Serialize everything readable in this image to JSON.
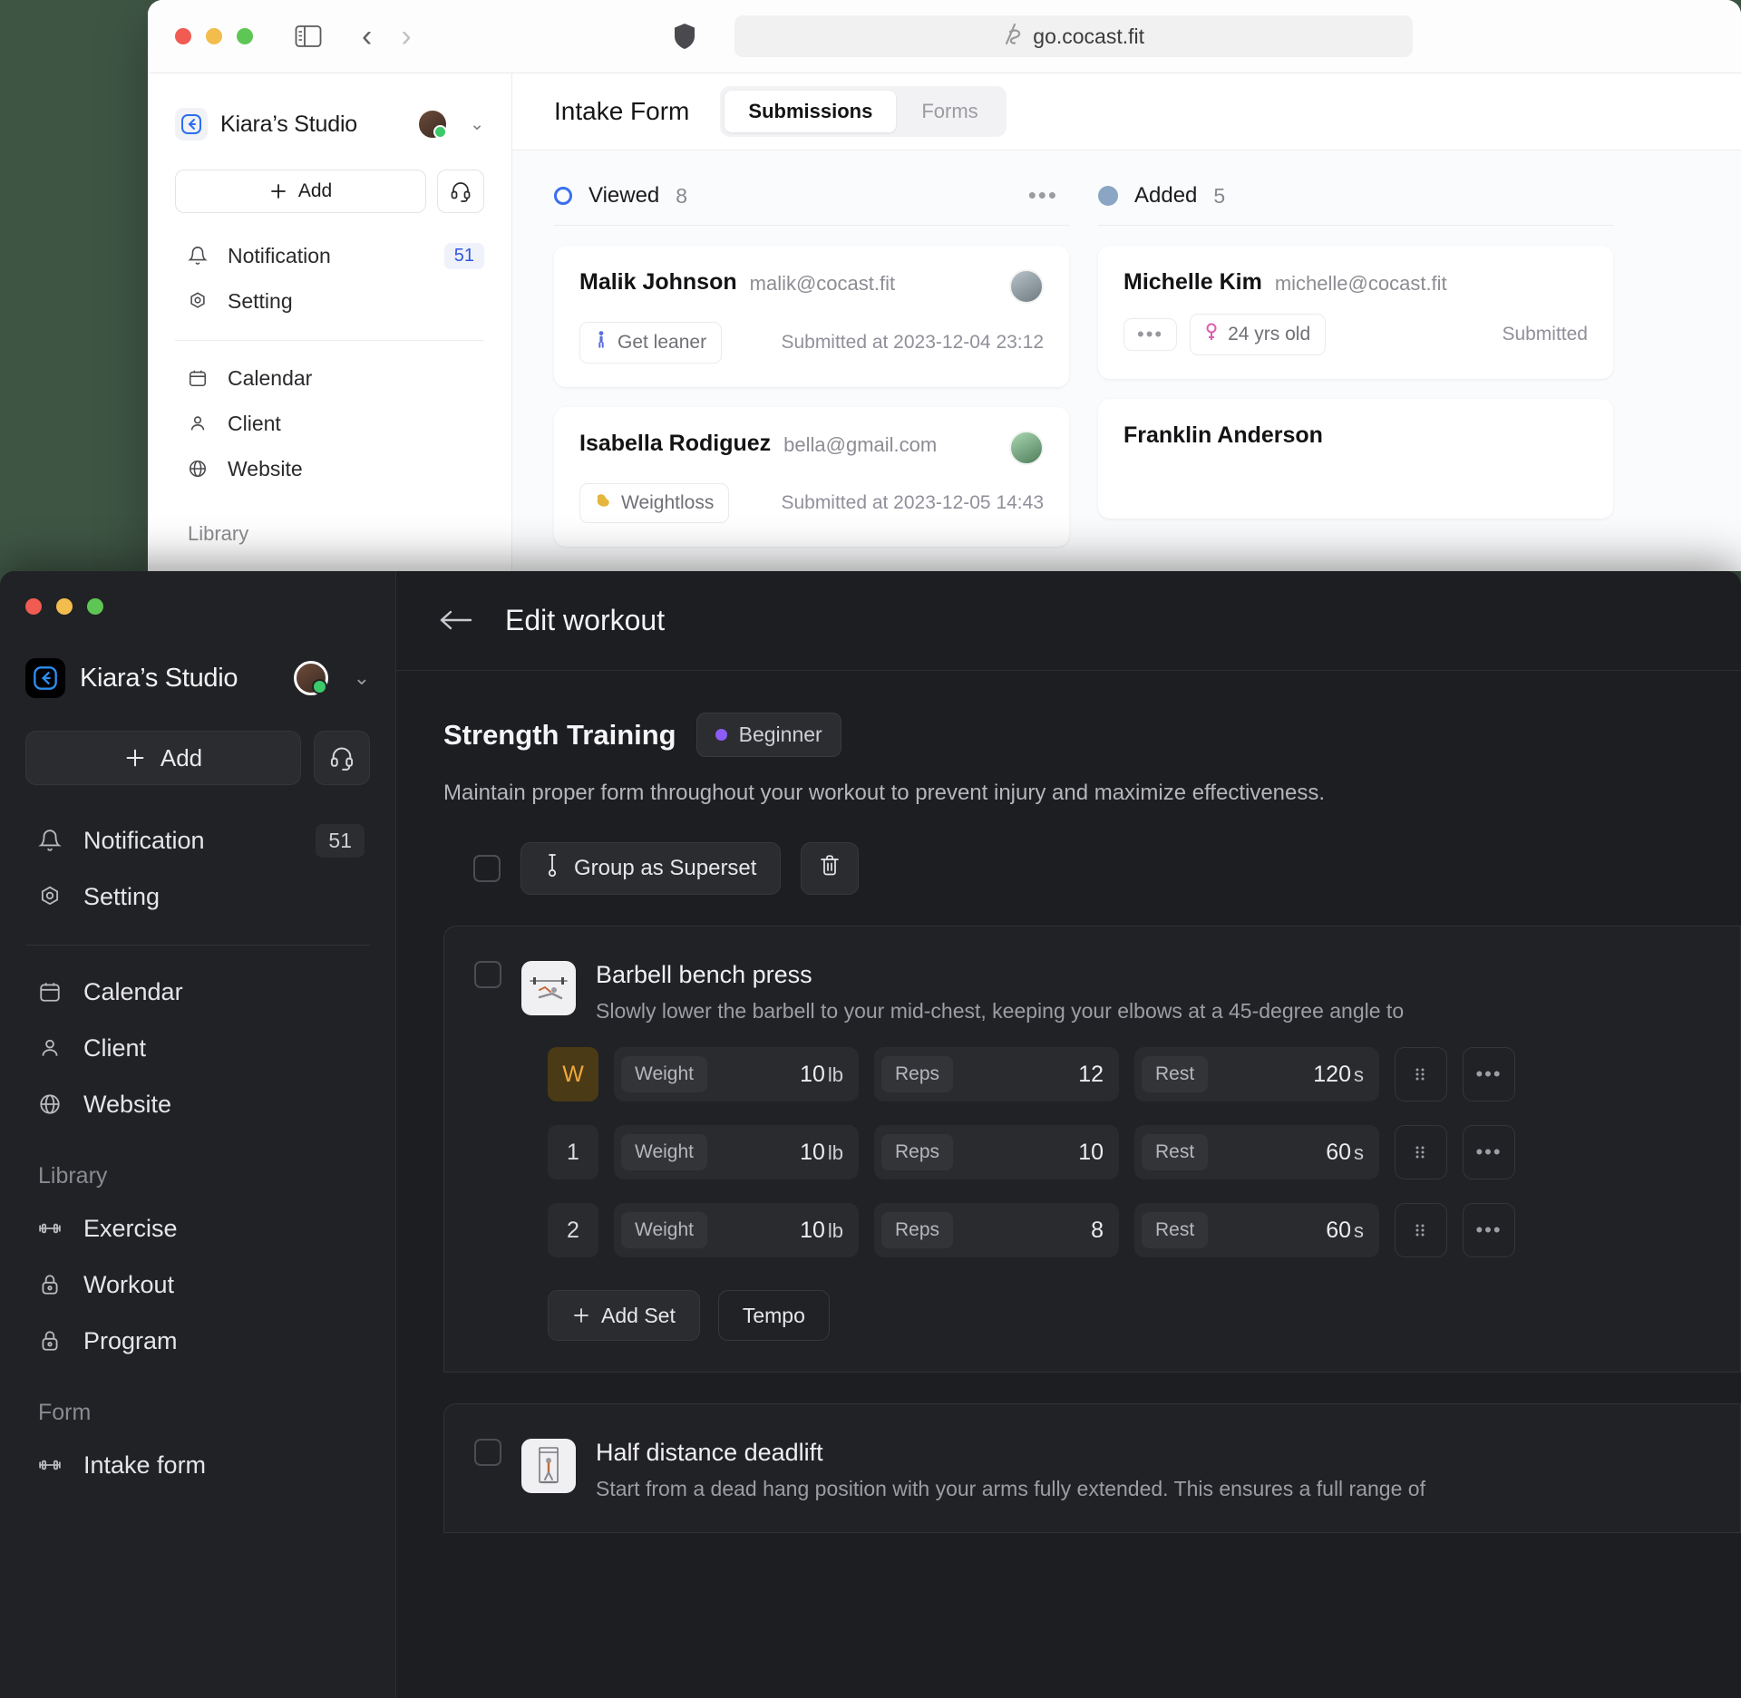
{
  "browser": {
    "url": "go.cocast.fit",
    "url_icon": "cocast-logo-icon",
    "back_label": "‹",
    "forward_label": "›"
  },
  "light_sidebar": {
    "workspace_name": "Kiara’s Studio",
    "add_label": "Add",
    "items": [
      {
        "label": "Notification",
        "icon": "bell-icon",
        "badge": "51"
      },
      {
        "label": "Setting",
        "icon": "gear-icon",
        "badge": ""
      }
    ],
    "items2": [
      {
        "label": "Calendar",
        "icon": "calendar-icon"
      },
      {
        "label": "Client",
        "icon": "user-icon"
      },
      {
        "label": "Website",
        "icon": "globe-icon"
      }
    ],
    "section_library": "Library"
  },
  "light_main": {
    "title": "Intake Form",
    "tabs": [
      {
        "label": "Submissions",
        "active": true
      },
      {
        "label": "Forms",
        "active": false
      }
    ],
    "columns": [
      {
        "title": "Viewed",
        "count": "8",
        "marker": "ring",
        "marker_color": "#3a6ff0",
        "has_more": true,
        "more_label": "•••",
        "cards": [
          {
            "name": "Malik Johnson",
            "email": "malik@cocast.fit",
            "tag_icon": "person-standing-icon",
            "tag": "Get leaner",
            "time": "Submitted at 2023-12-04 23:12"
          },
          {
            "name": "Isabella Rodiguez",
            "email": "bella@gmail.com",
            "tag_icon": "flexed-biceps-icon",
            "tag": "Weightloss",
            "time": "Submitted at 2023-12-05 14:43"
          }
        ]
      },
      {
        "title": "Added",
        "count": "5",
        "marker": "fill",
        "marker_color": "#8aa6c4",
        "has_more": false,
        "more_label": "",
        "cards": [
          {
            "name": "Michelle Kim",
            "email": "michelle@cocast.fit",
            "tag_icon": "female-sign-icon",
            "tag": "24 yrs old",
            "dots": "•••",
            "time": "Submitted"
          },
          {
            "name": "Franklin Anderson",
            "email": "",
            "tag_icon": "",
            "tag": "",
            "time": ""
          }
        ]
      }
    ]
  },
  "dark_sidebar": {
    "workspace_name": "Kiara’s Studio",
    "add_label": "Add",
    "items": [
      {
        "label": "Notification",
        "icon": "bell-icon",
        "badge": "51"
      },
      {
        "label": "Setting",
        "icon": "gear-icon",
        "badge": ""
      }
    ],
    "items2": [
      {
        "label": "Calendar",
        "icon": "calendar-icon"
      },
      {
        "label": "Client",
        "icon": "user-icon"
      },
      {
        "label": "Website",
        "icon": "globe-icon"
      }
    ],
    "section_library": "Library",
    "library_items": [
      {
        "label": "Exercise",
        "icon": "dumbbell-icon"
      },
      {
        "label": "Workout",
        "icon": "lock-icon"
      },
      {
        "label": "Program",
        "icon": "lock-icon"
      }
    ],
    "section_form": "Form",
    "form_items": [
      {
        "label": "Intake form",
        "icon": "dumbbell-icon"
      }
    ]
  },
  "dark_main": {
    "back_icon": "arrow-left-icon",
    "title": "Edit workout",
    "workout": {
      "name": "Strength Training",
      "level": "Beginner",
      "level_color": "#8b5cf6",
      "description": "Maintain proper form throughout your workout to prevent injury and maximize effectiveness.",
      "group_button": "Group as Superset",
      "group_icon": "superset-icon",
      "delete_icon": "trash-icon"
    },
    "exercises": [
      {
        "name": "Barbell bench press",
        "thumb": "barbell-bench-press-thumb",
        "description": "Slowly lower the barbell to your mid-chest, keeping your elbows at a 45-degree angle to",
        "sets": [
          {
            "index": "W",
            "warmup": true,
            "weight_label": "Weight",
            "weight": "10",
            "weight_unit": "lb",
            "reps_label": "Reps",
            "reps": "12",
            "rest_label": "Rest",
            "rest": "120",
            "rest_unit": "s"
          },
          {
            "index": "1",
            "warmup": false,
            "weight_label": "Weight",
            "weight": "10",
            "weight_unit": "lb",
            "reps_label": "Reps",
            "reps": "10",
            "rest_label": "Rest",
            "rest": "60",
            "rest_unit": "s"
          },
          {
            "index": "2",
            "warmup": false,
            "weight_label": "Weight",
            "weight": "10",
            "weight_unit": "lb",
            "reps_label": "Reps",
            "reps": "8",
            "rest_label": "Rest",
            "rest": "60",
            "rest_unit": "s"
          }
        ],
        "add_set_label": "Add Set",
        "tempo_label": "Tempo",
        "drag_icon": "drag-handle-icon",
        "more_icon": "more-horizontal-icon"
      },
      {
        "name": "Half distance deadlift",
        "thumb": "half-distance-deadlift-thumb",
        "description": "Start from a dead hang position with your arms fully extended. This ensures a full range of",
        "sets": [],
        "add_set_label": "",
        "tempo_label": ""
      }
    ]
  }
}
